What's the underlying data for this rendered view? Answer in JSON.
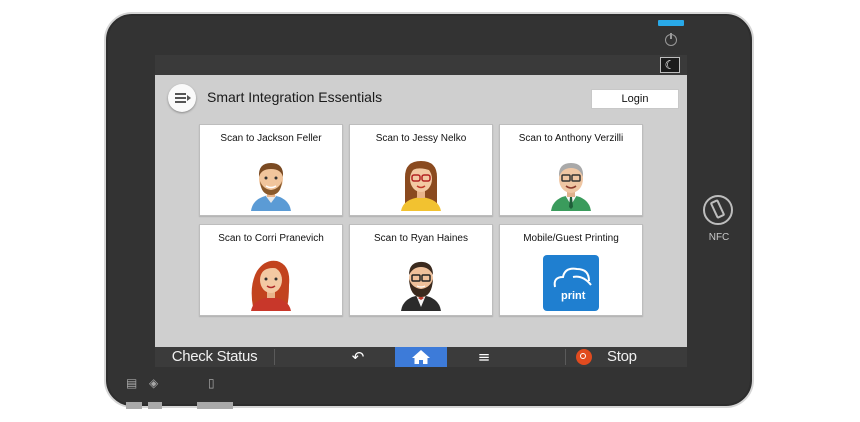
{
  "header": {
    "title": "Smart Integration Essentials",
    "login_label": "Login"
  },
  "tiles": [
    {
      "label": "Scan to Jackson Feller",
      "icon": "avatar-man-brown-beard"
    },
    {
      "label": "Scan to Jessy Nelko",
      "icon": "avatar-woman-glasses"
    },
    {
      "label": "Scan to Anthony Verzilli",
      "icon": "avatar-man-gray-glasses"
    },
    {
      "label": "Scan to Corri Pranevich",
      "icon": "avatar-woman-red-hair"
    },
    {
      "label": "Scan to Ryan Haines",
      "icon": "avatar-man-beard-glasses"
    },
    {
      "label": "Mobile/Guest Printing",
      "icon": "print-cloud-icon",
      "icon_text": "print"
    }
  ],
  "bottom_bar": {
    "check_status": "Check Status",
    "stop": "Stop"
  },
  "device": {
    "nfc_label": "NFC"
  },
  "colors": {
    "home_active": "#3d7bd9",
    "stop_red": "#e14b1f",
    "print_blue": "#1f7fd0",
    "led_blue": "#29a9e8"
  }
}
